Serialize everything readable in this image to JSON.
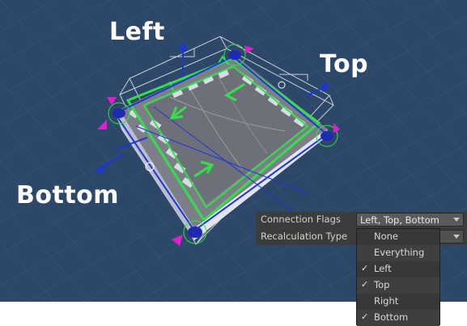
{
  "scene": {
    "callouts": {
      "left": "Left",
      "top": "Top",
      "bottom": "Bottom"
    },
    "colors": {
      "background": "#2c4768",
      "grid": "#3b5a80",
      "selection": "#33e04a",
      "gizmo_blue": "#1d36d8",
      "handle_magenta": "#e020d0",
      "tile_top": "#7d7f88",
      "tile_side": "#c9cdd9",
      "stripe": "#d8dce6"
    }
  },
  "inspector": {
    "connection_flags": {
      "label": "Connection Flags",
      "value": "Left, Top, Bottom"
    },
    "recalculation_type": {
      "label": "Recalculation Type",
      "value": ""
    }
  },
  "dropdown": {
    "items": [
      {
        "label": "None",
        "checked": false
      },
      {
        "label": "Everything",
        "checked": false
      },
      {
        "label": "Left",
        "checked": true
      },
      {
        "label": "Top",
        "checked": true
      },
      {
        "label": "Right",
        "checked": false
      },
      {
        "label": "Bottom",
        "checked": true
      }
    ],
    "check_glyph": "✓"
  }
}
